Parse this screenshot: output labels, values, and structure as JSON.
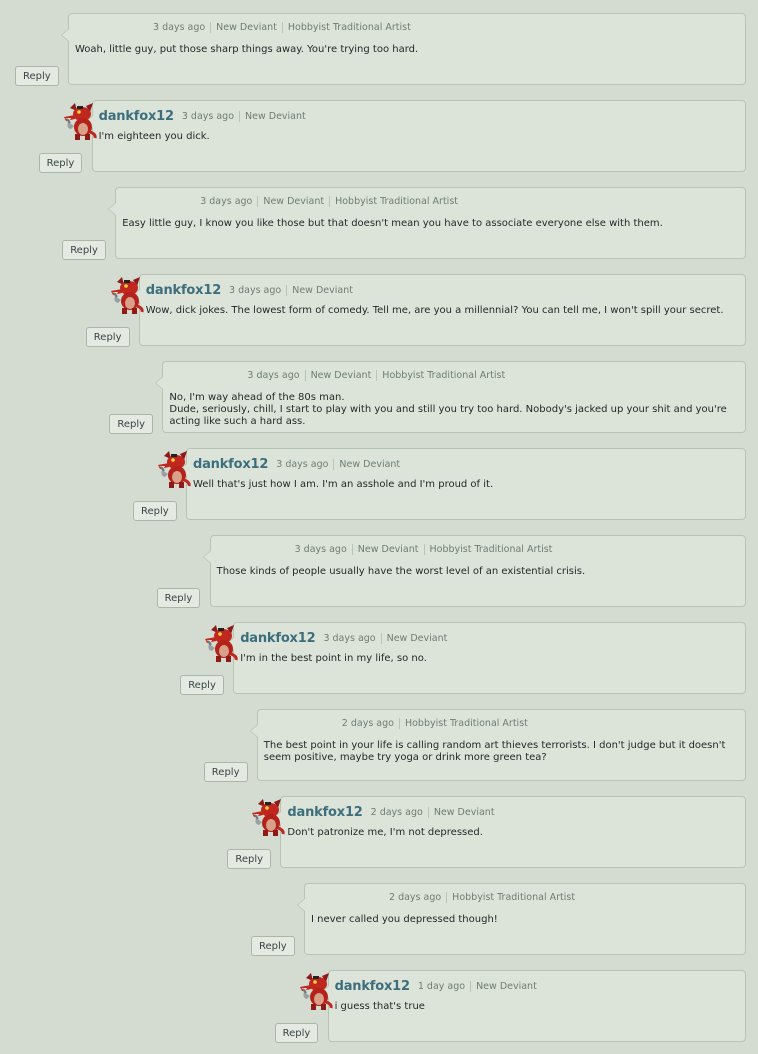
{
  "comments": [
    {
      "user": "",
      "time": "3 days ago",
      "badges": [
        "New Deviant",
        "Hobbyist Traditional Artist"
      ],
      "lines": [
        "Woah, little guy, put those sharp things away. You're trying too hard."
      ],
      "reply": "Reply"
    },
    {
      "user": "dankfox12",
      "time": "3 days ago",
      "badges": [
        "New Deviant"
      ],
      "lines": [
        "I'm eighteen you dick."
      ],
      "reply": "Reply"
    },
    {
      "user": "",
      "time": "3 days ago",
      "badges": [
        "New Deviant",
        "Hobbyist Traditional Artist"
      ],
      "lines": [
        "Easy little guy, I know you like those but that doesn't mean you have to associate everyone else with them."
      ],
      "reply": "Reply"
    },
    {
      "user": "dankfox12",
      "time": "3 days ago",
      "badges": [
        "New Deviant"
      ],
      "lines": [
        "Wow, dick jokes. The lowest form of comedy. Tell me, are you a millennial? You can tell me, I won't spill your secret."
      ],
      "reply": "Reply"
    },
    {
      "user": "",
      "time": "3 days ago",
      "badges": [
        "New Deviant",
        "Hobbyist Traditional Artist"
      ],
      "lines": [
        "No, I'm way ahead of the 80s man.",
        "Dude, seriously, chill, I start to play with you and still you try too hard. Nobody's jacked up your shit and you're acting like such a hard ass."
      ],
      "reply": "Reply"
    },
    {
      "user": "dankfox12",
      "time": "3 days ago",
      "badges": [
        "New Deviant"
      ],
      "lines": [
        "Well that's just how I am. I'm an asshole and I'm proud of it."
      ],
      "reply": "Reply"
    },
    {
      "user": "",
      "time": "3 days ago",
      "badges": [
        "New Deviant",
        "Hobbyist Traditional Artist"
      ],
      "lines": [
        "Those kinds of people usually have the worst level of an existential crisis."
      ],
      "reply": "Reply"
    },
    {
      "user": "dankfox12",
      "time": "3 days ago",
      "badges": [
        "New Deviant"
      ],
      "lines": [
        "I'm in the best point in my life, so no."
      ],
      "reply": "Reply"
    },
    {
      "user": "",
      "time": "2 days ago",
      "badges": [
        "Hobbyist Traditional Artist"
      ],
      "lines": [
        "The best point in your life is calling random art thieves terrorists. I don't judge but it doesn't seem positive, maybe try yoga or drink more green tea?"
      ],
      "reply": "Reply"
    },
    {
      "user": "dankfox12",
      "time": "2 days ago",
      "badges": [
        "New Deviant"
      ],
      "lines": [
        "Don't patronize me, I'm not depressed."
      ],
      "reply": "Reply"
    },
    {
      "user": "",
      "time": "2 days ago",
      "badges": [
        "Hobbyist Traditional Artist"
      ],
      "lines": [
        "I never called you depressed though!"
      ],
      "reply": "Reply"
    },
    {
      "user": "dankfox12",
      "time": "1 day ago",
      "badges": [
        "New Deviant"
      ],
      "lines": [
        "i guess that's true"
      ],
      "reply": "Reply"
    }
  ],
  "colors": {
    "background": "#d4dcd2",
    "bubble": "#dce4da",
    "username": "#3d6e7c"
  },
  "avatar_icon": "red-fox-avatar-icon"
}
